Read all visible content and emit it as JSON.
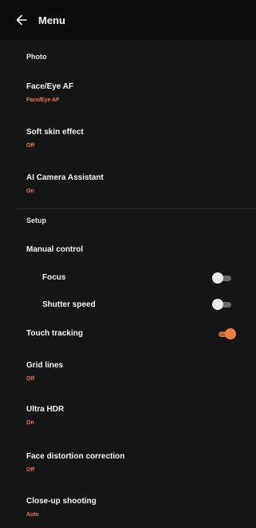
{
  "header": {
    "title": "Menu",
    "back_icon": "arrow-left-icon"
  },
  "sections": {
    "photo_label": "Photo",
    "setup_label": "Setup"
  },
  "items": {
    "face_eye_af": {
      "title": "Face/Eye AF",
      "value": "Face/Eye AF"
    },
    "soft_skin": {
      "title": "Soft skin effect",
      "value": "Off"
    },
    "ai_assistant": {
      "title": "AI Camera Assistant",
      "value": "On"
    },
    "manual_control": {
      "title": "Manual control"
    },
    "focus": {
      "title": "Focus",
      "toggle": false
    },
    "shutter_speed": {
      "title": "Shutter speed",
      "toggle": false
    },
    "touch_tracking": {
      "title": "Touch tracking",
      "toggle": true
    },
    "grid_lines": {
      "title": "Grid lines",
      "value": "Off"
    },
    "ultra_hdr": {
      "title": "Ultra HDR",
      "value": "On"
    },
    "face_distortion": {
      "title": "Face distortion correction",
      "value": "Off"
    },
    "closeup": {
      "title": "Close-up shooting",
      "value": "Auto"
    }
  },
  "colors": {
    "accent": "#ee7733",
    "background": "#151515",
    "header": "#0b0b0b"
  }
}
